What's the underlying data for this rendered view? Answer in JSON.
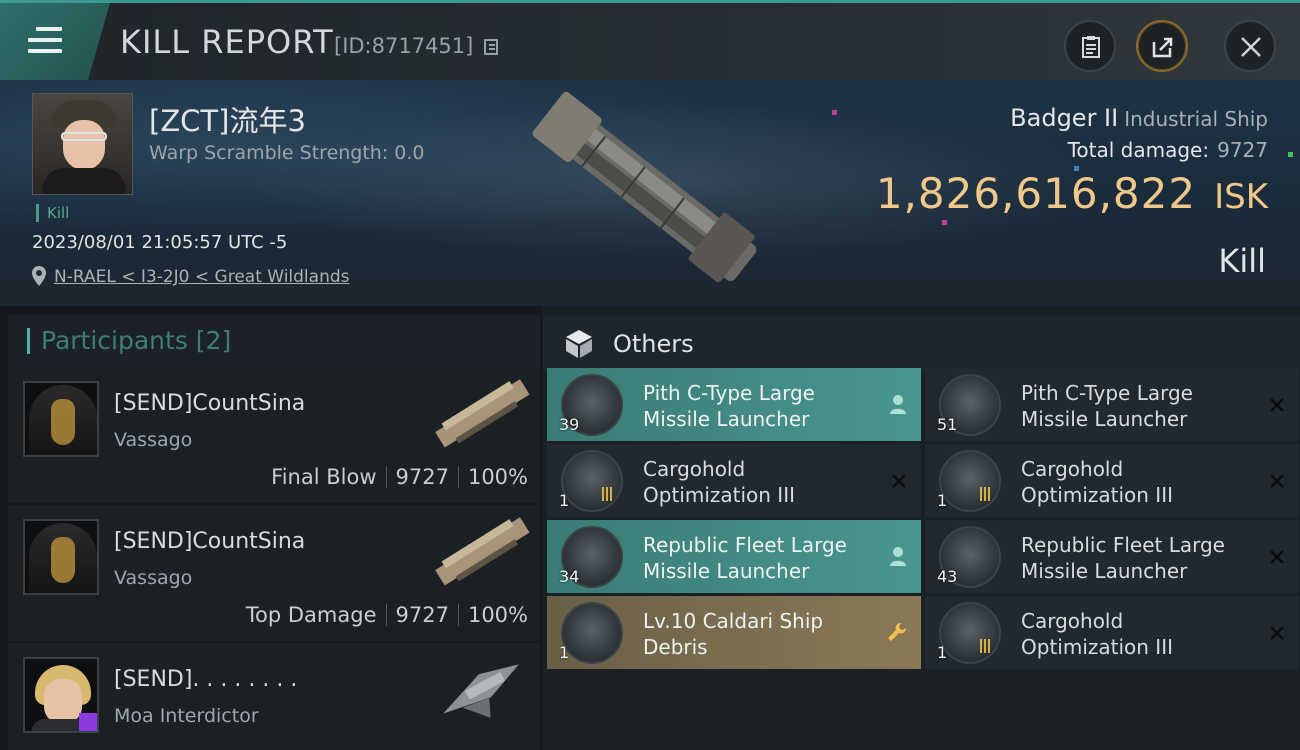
{
  "header": {
    "title": "KILL REPORT",
    "report_id": "[ID:8717451]"
  },
  "victim": {
    "name": "[ZCT]流年3",
    "warp_scramble": "Warp Scramble Strength: 0.0",
    "tag": "Kill",
    "datetime": "2023/08/01 21:05:57 UTC -5",
    "location": "N-RAEL < I3-2J0 < Great Wildlands",
    "ship_name": "Badger II",
    "ship_class": "Industrial Ship",
    "damage_label": "Total damage:",
    "damage_value": "9727",
    "isk_value": "1,826,616,822",
    "isk_unit": "ISK",
    "result": "Kill"
  },
  "participants": {
    "title": "Participants [2]",
    "items": [
      {
        "name": "[SEND]CountSina",
        "ship": "Vassago",
        "role": "Final Blow",
        "damage": "9727",
        "percent": "100%"
      },
      {
        "name": "[SEND]CountSina",
        "ship": "Vassago",
        "role": "Top Damage",
        "damage": "9727",
        "percent": "100%"
      },
      {
        "name": "[SEND]. . . . . . . .",
        "ship": "Moa Interdictor"
      }
    ]
  },
  "others": {
    "title": "Others",
    "items": [
      {
        "line1": "Pith C-Type Large",
        "line2": "Missile Launcher",
        "qty": "39",
        "style": "teal",
        "status_icon": "person-icon"
      },
      {
        "line1": "Pith C-Type Large",
        "line2": "Missile Launcher",
        "qty": "51",
        "style": "dark",
        "status_icon": "x-icon"
      },
      {
        "line1": "Cargohold",
        "line2": "Optimization III",
        "qty": "1",
        "style": "dark",
        "status_icon": "x-icon"
      },
      {
        "line1": "Cargohold",
        "line2": "Optimization III",
        "qty": "1",
        "style": "dark",
        "status_icon": "x-icon"
      },
      {
        "line1": "Republic Fleet Large",
        "line2": "Missile Launcher",
        "qty": "34",
        "style": "teal",
        "status_icon": "person-icon"
      },
      {
        "line1": "Republic Fleet Large",
        "line2": "Missile Launcher",
        "qty": "43",
        "style": "dark",
        "status_icon": "x-icon"
      },
      {
        "line1": "Lv.10 Caldari Ship",
        "line2": "Debris",
        "qty": "1",
        "style": "gold",
        "status_icon": "wrench-icon"
      },
      {
        "line1": "Cargohold",
        "line2": "Optimization III",
        "qty": "1",
        "style": "dark",
        "status_icon": "x-icon"
      }
    ]
  },
  "colors": {
    "accent_teal": "#4a9790",
    "isk_gold": "#f0c98a",
    "debris_gold": "#8a7a56"
  }
}
